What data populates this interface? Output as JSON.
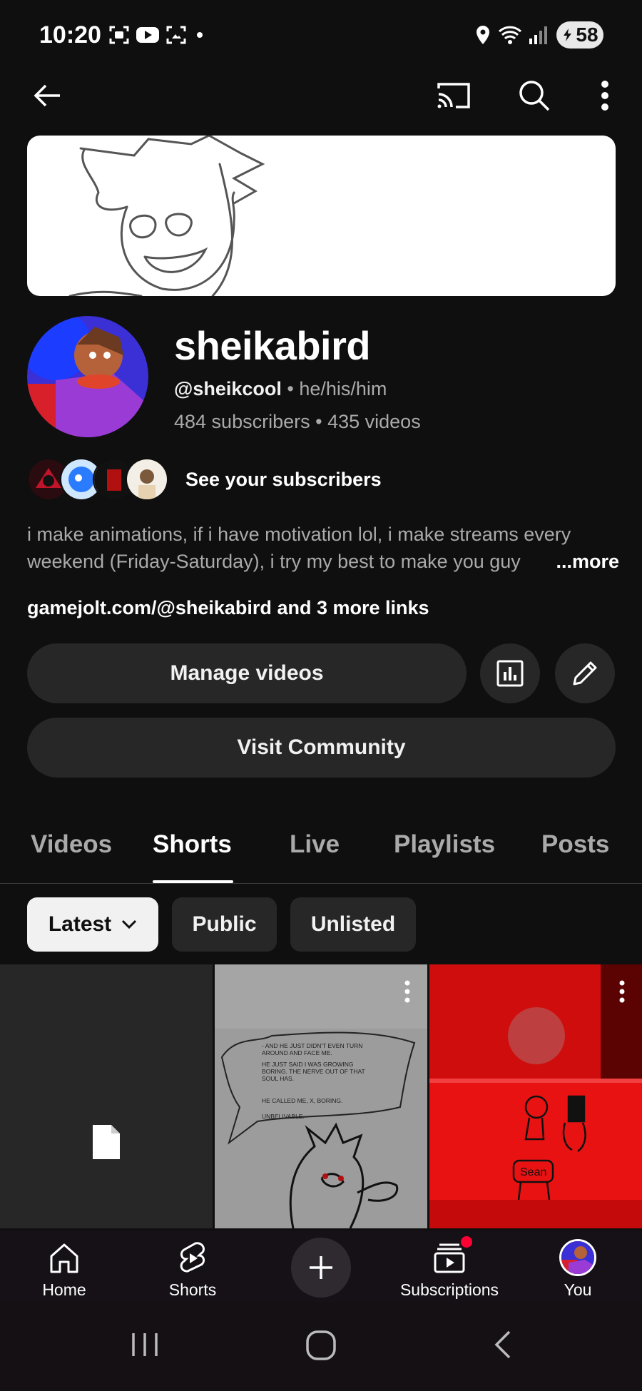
{
  "status_bar": {
    "time": "10:20",
    "battery": "58",
    "icons": [
      "screenshot-icon",
      "youtube-icon",
      "gallery-icon",
      "dot-icon",
      "location-icon",
      "wifi-icon",
      "signal-icon",
      "battery-icon"
    ]
  },
  "top_bar": {
    "icons": [
      "back-icon",
      "cast-icon",
      "search-icon",
      "more-vert-icon"
    ]
  },
  "channel": {
    "name": "sheikabird",
    "handle": "@sheikcool",
    "pronouns": "he/his/him",
    "subscribers": "484 subscribers",
    "videos": "435 videos",
    "separator": "•",
    "see_subscribers": "See your subscribers",
    "description": "i make animations, if i have motivation lol, i make streams every weekend (Friday-Saturday), i try my best to make you guy",
    "more_label": "...more",
    "link": "gamejolt.com/@sheikabird",
    "more_links": "and 3 more links"
  },
  "actions": {
    "manage_videos": "Manage videos",
    "visit_community": "Visit Community"
  },
  "tabs": [
    "Videos",
    "Shorts",
    "Live",
    "Playlists",
    "Posts"
  ],
  "active_tab": "Shorts",
  "filters": {
    "chips": [
      "Latest",
      "Public",
      "Unlisted"
    ],
    "selected": "Latest"
  },
  "shorts_thumbnails": {
    "comic_text": [
      "- AND HE JUST DIDN'T EVEN TURN",
      "AROUND AND FACE ME.",
      "HE JUST SAID I WAS GROWING",
      "BORING. THE NERVE OUT OF THAT",
      "SOUL HAS.",
      "HE CALLED ME, X, BORING.",
      "UNBELIVABLE."
    ],
    "sign_text": "Sean"
  },
  "bottom_nav": {
    "items": [
      "Home",
      "Shorts",
      "",
      "Subscriptions",
      "You"
    ]
  },
  "colors": {
    "background": "#0f0f0f",
    "surface": "#272727",
    "text": "#f1f1f1",
    "secondary_text": "#aaaaaa",
    "notification": "#ff0033"
  }
}
